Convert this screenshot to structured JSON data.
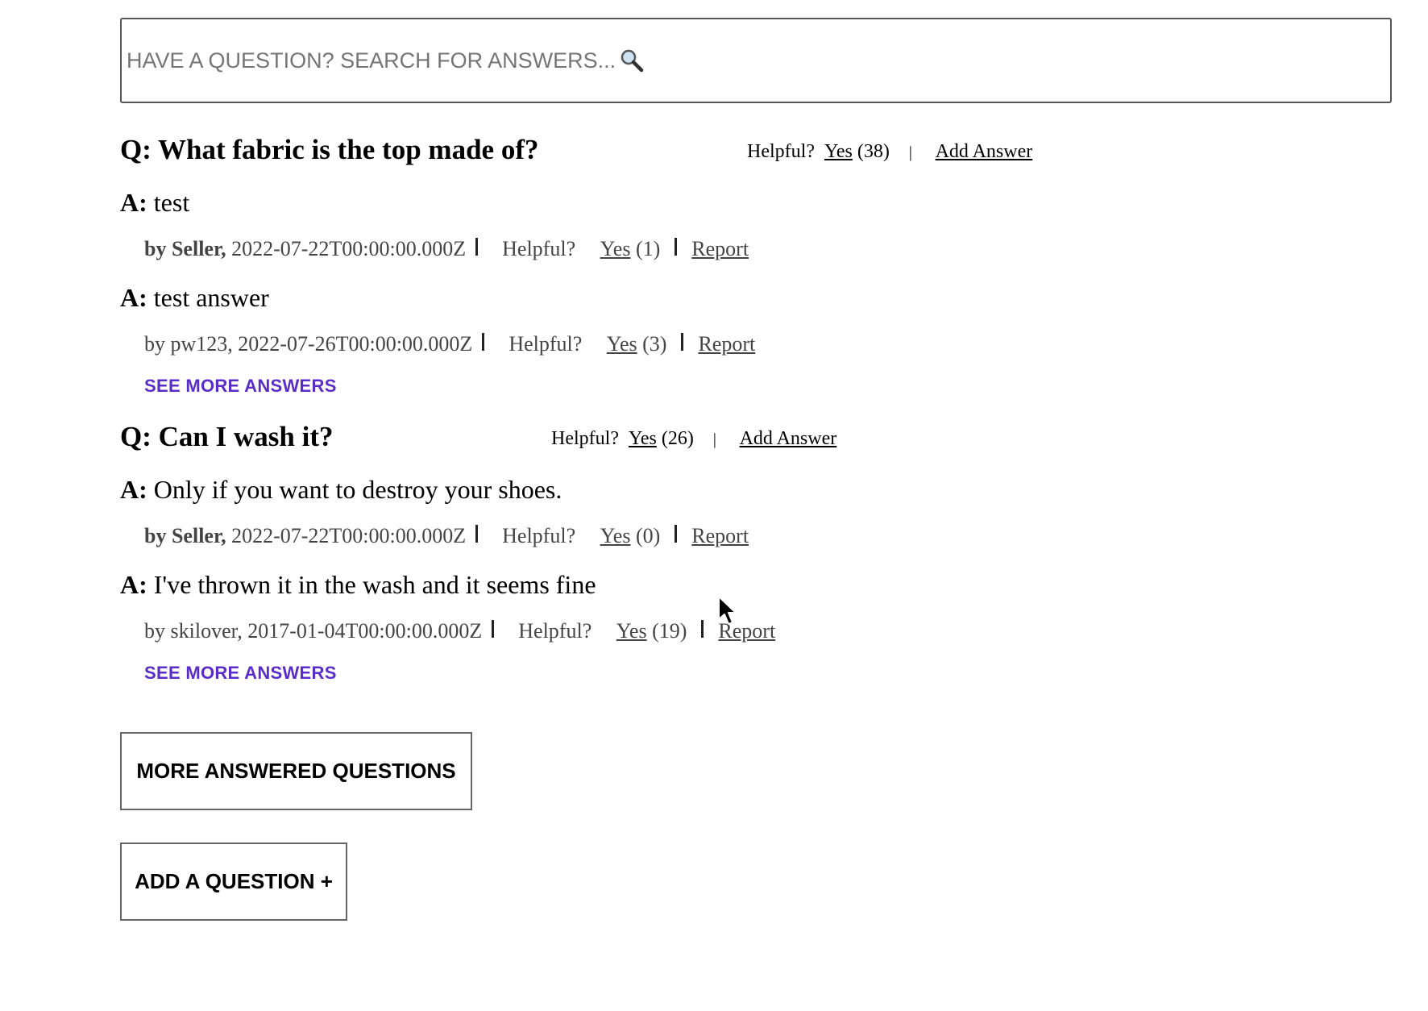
{
  "search": {
    "placeholder": "HAVE A QUESTION? SEARCH FOR ANSWERS..."
  },
  "questions": [
    {
      "prefix": "Q:",
      "text": "What fabric is the top made of?",
      "helpful_label": "Helpful?",
      "yes_label": "Yes",
      "helpful_count": "(38)",
      "separator": "|",
      "add_answer_label": "Add Answer",
      "answers": [
        {
          "prefix": "A:",
          "body": "test",
          "by": "by",
          "author": "Seller,",
          "date": "2022-07-22T00:00:00.000Z",
          "helpful_label": "Helpful?",
          "yes_label": "Yes",
          "helpful_count": "(1)",
          "report_label": "Report"
        },
        {
          "prefix": "A:",
          "body": "test answer",
          "by": "by",
          "author": "pw123,",
          "date": "2022-07-26T00:00:00.000Z",
          "helpful_label": "Helpful?",
          "yes_label": "Yes",
          "helpful_count": "(3)",
          "report_label": "Report"
        }
      ],
      "see_more_label": "SEE MORE ANSWERS"
    },
    {
      "prefix": "Q:",
      "text": "Can I wash it?",
      "helpful_label": "Helpful?",
      "yes_label": "Yes",
      "helpful_count": "(26)",
      "separator": "|",
      "add_answer_label": "Add Answer",
      "answers": [
        {
          "prefix": "A:",
          "body": "Only if you want to destroy your shoes.",
          "by": "by",
          "author": "Seller,",
          "date": "2022-07-22T00:00:00.000Z",
          "helpful_label": "Helpful?",
          "yes_label": "Yes",
          "helpful_count": "(0)",
          "report_label": "Report"
        },
        {
          "prefix": "A:",
          "body": "I've thrown it in the wash and it seems fine",
          "by": "by",
          "author": "skilover,",
          "date": "2017-01-04T00:00:00.000Z",
          "helpful_label": "Helpful?",
          "yes_label": "Yes",
          "helpful_count": "(19)",
          "report_label": "Report"
        }
      ],
      "see_more_label": "SEE MORE ANSWERS"
    }
  ],
  "buttons": {
    "more_questions": "MORE ANSWERED QUESTIONS",
    "add_question": "ADD A QUESTION +"
  },
  "colors": {
    "see_more": "#5a2dc8",
    "border": "#555555",
    "placeholder": "#777777"
  },
  "icons": {
    "search": "magnifying-glass",
    "cursor": "mouse-pointer"
  }
}
